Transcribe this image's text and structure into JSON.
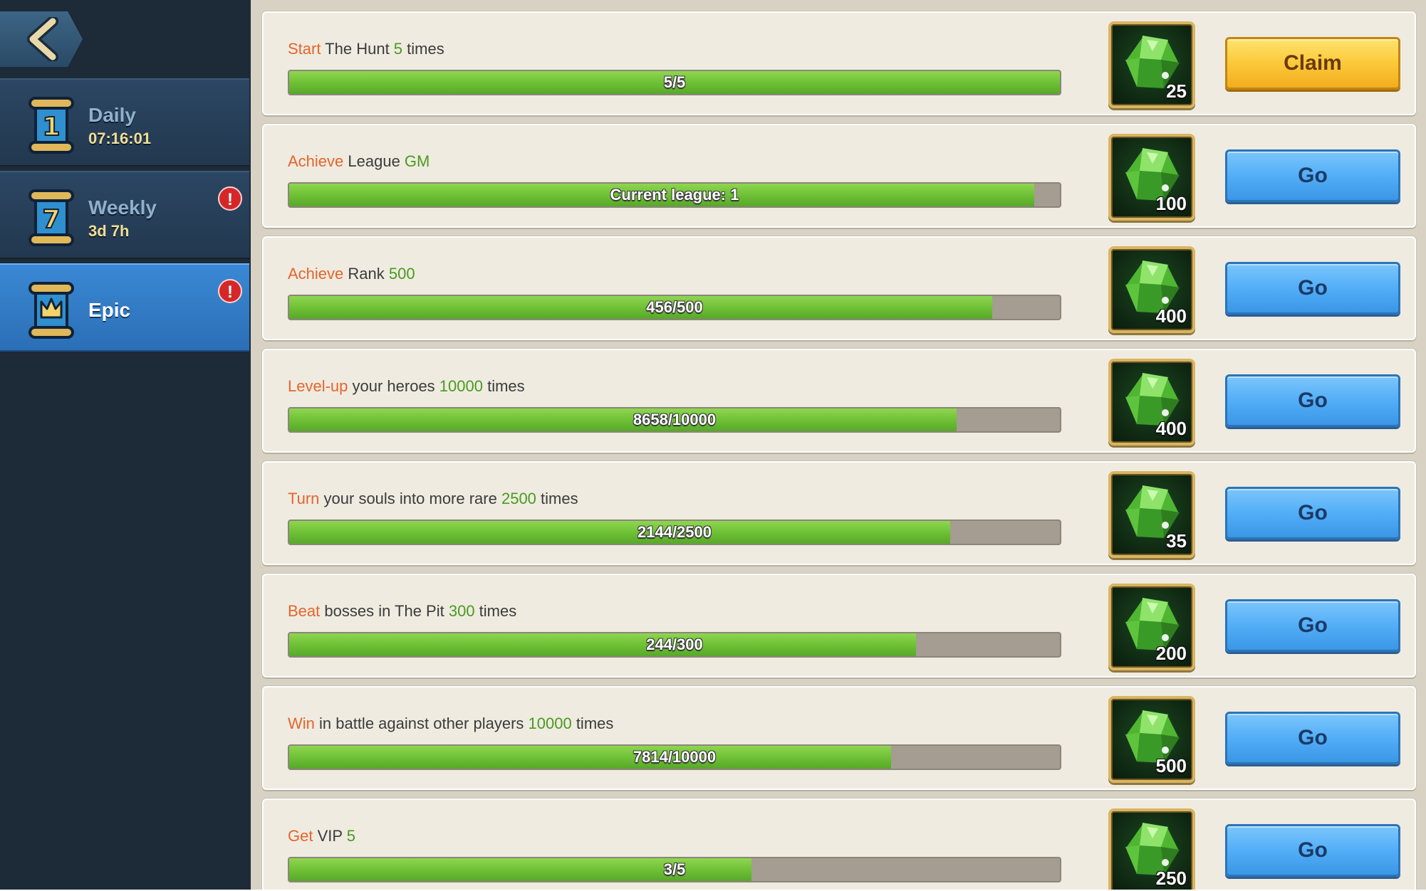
{
  "colors": {
    "sidebar_bg": "#1d2a38",
    "tab_active": "#2f7dc9",
    "main_bg": "#d7d2c3",
    "card_bg": "#efebe1",
    "verb": "#e5652b",
    "number": "#4a9a1e",
    "progress_fill": "#6cbf34",
    "progress_track": "#a59d91",
    "go_button": "#52aef7",
    "claim_button": "#fbc93a",
    "alert": "#d42828"
  },
  "sidebar": {
    "back_icon": "chevron-left-icon",
    "tabs": [
      {
        "label": "Daily",
        "timer": "07:16:01",
        "icon": "scroll-1-icon",
        "alert": ""
      },
      {
        "label": "Weekly",
        "timer": "3d 7h",
        "icon": "scroll-7-icon",
        "alert": "!"
      },
      {
        "label": "Epic",
        "timer": "",
        "icon": "scroll-crown-icon",
        "alert": "!",
        "active": true
      }
    ]
  },
  "quests": [
    {
      "verb": "Start",
      "pre": " The Hunt ",
      "num": "5",
      "post": " times",
      "progress_text": "5/5",
      "progress": 1.0,
      "reward": "25",
      "reward_icon": "emerald-gem-icon",
      "action": "Claim",
      "action_type": "claim"
    },
    {
      "verb": "Achieve",
      "pre": " League ",
      "num": "GM",
      "post": "",
      "progress_text": "Current league: 1",
      "progress": 0.967,
      "reward": "100",
      "reward_icon": "emerald-gem-icon",
      "action": "Go",
      "action_type": "go"
    },
    {
      "verb": "Achieve",
      "pre": " Rank ",
      "num": "500",
      "post": "",
      "progress_text": "456/500",
      "progress": 0.912,
      "reward": "400",
      "reward_icon": "emerald-gem-icon",
      "action": "Go",
      "action_type": "go"
    },
    {
      "verb": "Level-up",
      "pre": " your heroes ",
      "num": "10000",
      "post": " times",
      "progress_text": "8658/10000",
      "progress": 0.8658,
      "reward": "400",
      "reward_icon": "emerald-gem-icon",
      "action": "Go",
      "action_type": "go"
    },
    {
      "verb": "Turn",
      "pre": " your souls into more rare ",
      "num": "2500",
      "post": " times",
      "progress_text": "2144/2500",
      "progress": 0.8576,
      "reward": "35",
      "reward_icon": "emerald-gem-icon",
      "action": "Go",
      "action_type": "go"
    },
    {
      "verb": "Beat",
      "pre": " bosses in The Pit ",
      "num": "300",
      "post": " times",
      "progress_text": "244/300",
      "progress": 0.813,
      "reward": "200",
      "reward_icon": "emerald-gem-icon",
      "action": "Go",
      "action_type": "go"
    },
    {
      "verb": "Win",
      "pre": " in battle against other players ",
      "num": "10000",
      "post": " times",
      "progress_text": "7814/10000",
      "progress": 0.7814,
      "reward": "500",
      "reward_icon": "emerald-gem-icon",
      "action": "Go",
      "action_type": "go"
    },
    {
      "verb": "Get",
      "pre": " VIP ",
      "num": "5",
      "post": "",
      "progress_text": "3/5",
      "progress": 0.6,
      "reward": "250",
      "reward_icon": "emerald-gem-icon",
      "action": "Go",
      "action_type": "go"
    }
  ]
}
